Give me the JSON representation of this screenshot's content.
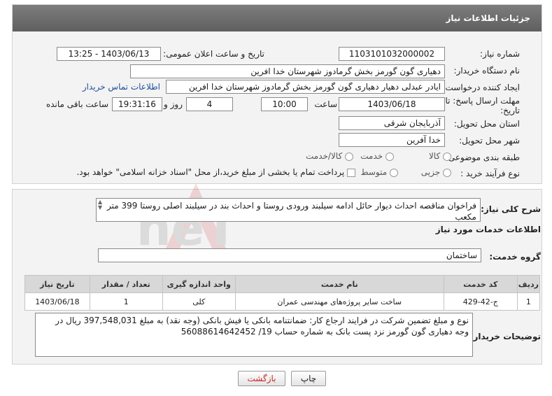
{
  "header": {
    "title": "جزئیات اطلاعات نیاز"
  },
  "form": {
    "need_number_label": "شماره نیاز:",
    "need_number": "1103101032000002",
    "announce_label": "تاریخ و ساعت اعلان عمومی:",
    "announce_value": "1403/06/13 - 13:25",
    "buyer_label": "نام دستگاه خریدار:",
    "buyer_value": "دهیاری گون گورمز بخش گرمادوز شهرستان خدا افرین",
    "creator_label": "ایجاد کننده درخواست:",
    "creator_value": "ایادر عبدلی دهیار دهیاری گون گورمز بخش گرمادوز شهرستان خدا افرین",
    "contact_link": "اطلاعات تماس خریدار",
    "deadline_label_1": "مهلت ارسال پاسخ: تا",
    "deadline_label_2": "تاریخ:",
    "deadline_date": "1403/06/18",
    "time_label": "ساعت",
    "deadline_time": "10:00",
    "days_value": "4",
    "days_label": "روز و",
    "remaining_time": "19:31:16",
    "remaining_label": "ساعت باقی مانده",
    "province_label": "استان محل تحویل:",
    "province_value": "آذربایجان شرقی",
    "city_label": "شهر محل تحویل:",
    "city_value": "خدا آفرین",
    "category_label": "طبقه بندی موضوعی:",
    "category_options": [
      "کالا",
      "خدمت",
      "کالا/خدمت"
    ],
    "process_label": "نوع فرآیند خرید :",
    "process_options": [
      "جزیی",
      "متوسط"
    ],
    "payment_note": "پرداخت تمام یا بخشی از مبلغ خرید،از محل \"اسناد خزانه اسلامی\" خواهد بود."
  },
  "details": {
    "summary_label": "شرح کلی نیاز:",
    "summary_value": "فراخوان مناقصه احداث دیوار حائل ادامه سیلبند ورودی روستا و احداث بند در سیلبند اصلی روستا 399 متر مکعب",
    "services_title": "اطلاعات خدمات مورد نیاز",
    "service_group_label": "گروه خدمت:",
    "service_group_value": "ساختمان",
    "table": {
      "headers": [
        "ردیف",
        "کد خدمت",
        "نام خدمت",
        "واحد اندازه گیری",
        "تعداد / مقدار",
        "تاریخ نیاز"
      ],
      "rows": [
        [
          "1",
          "ج-42-429",
          "ساخت سایر پروژه‌های مهندسی عمران",
          "کلی",
          "1",
          "1403/06/18"
        ]
      ]
    },
    "buyer_notes_label": "توضیحات خریدار:",
    "buyer_notes": "نوع و مبلغ تضمین شرکت در فرایند ارجاع کار:  ضمانتنامه بانکی یا  فیش بانکی (وجه نقد)  به مبلغ 397,548,031 ریال در وجه دهیاری گون گورمز نزد پست بانک به شماره حساب 19/ 56088614642452"
  },
  "buttons": {
    "print": "چاپ",
    "back": "بازگشت"
  },
  "watermark": {
    "text": "AriaTender.neT"
  }
}
